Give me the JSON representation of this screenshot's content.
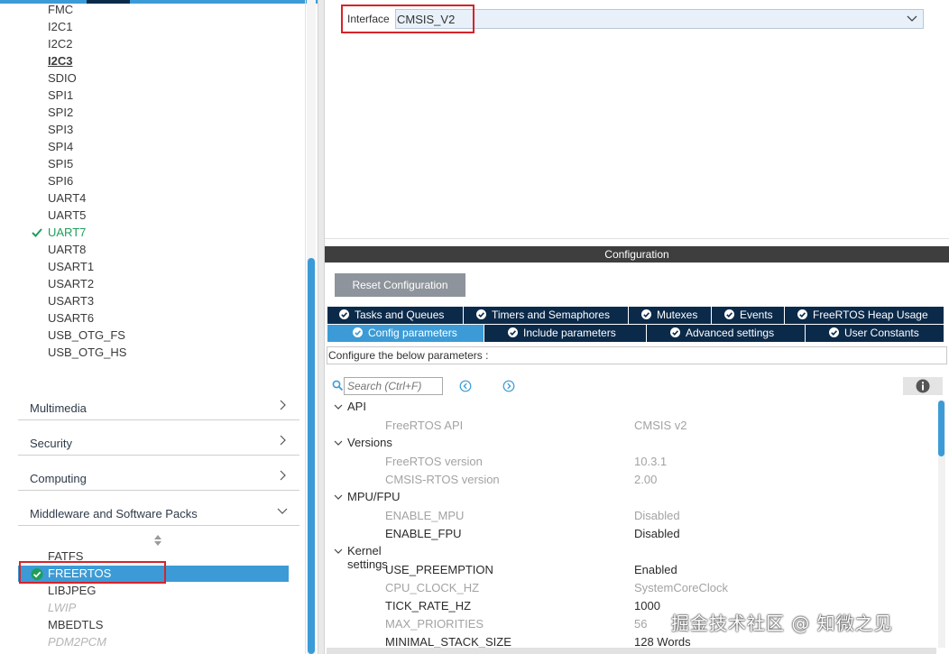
{
  "peripherals": [
    {
      "label": "FMC",
      "style": "normal"
    },
    {
      "label": "I2C1",
      "style": "normal"
    },
    {
      "label": "I2C2",
      "style": "normal"
    },
    {
      "label": "I2C3",
      "style": "bold"
    },
    {
      "label": "SDIO",
      "style": "normal"
    },
    {
      "label": "SPI1",
      "style": "normal"
    },
    {
      "label": "SPI2",
      "style": "normal"
    },
    {
      "label": "SPI3",
      "style": "normal"
    },
    {
      "label": "SPI4",
      "style": "normal"
    },
    {
      "label": "SPI5",
      "style": "normal"
    },
    {
      "label": "SPI6",
      "style": "normal"
    },
    {
      "label": "UART4",
      "style": "normal"
    },
    {
      "label": "UART5",
      "style": "normal"
    },
    {
      "label": "UART7",
      "style": "green"
    },
    {
      "label": "UART8",
      "style": "normal"
    },
    {
      "label": "USART1",
      "style": "normal"
    },
    {
      "label": "USART2",
      "style": "normal"
    },
    {
      "label": "USART3",
      "style": "normal"
    },
    {
      "label": "USART6",
      "style": "normal"
    },
    {
      "label": "USB_OTG_FS",
      "style": "normal"
    },
    {
      "label": "USB_OTG_HS",
      "style": "normal"
    }
  ],
  "categories": [
    {
      "label": "Multimedia",
      "state": "collapsed"
    },
    {
      "label": "Security",
      "state": "collapsed"
    },
    {
      "label": "Computing",
      "state": "collapsed"
    },
    {
      "label": "Middleware and Software Packs",
      "state": "expanded"
    }
  ],
  "middleware": [
    {
      "label": "FATFS",
      "style": "normal"
    },
    {
      "label": "FREERTOS",
      "style": "selected"
    },
    {
      "label": "LIBJPEG",
      "style": "normal"
    },
    {
      "label": "LWIP",
      "style": "disabled"
    },
    {
      "label": "MBEDTLS",
      "style": "normal"
    },
    {
      "label": "PDM2PCM",
      "style": "disabled"
    }
  ],
  "interface": {
    "label": "Interface",
    "value": "CMSIS_V2"
  },
  "configuration": {
    "title": "Configuration",
    "reset_label": "Reset Configuration",
    "tabs_row1": [
      {
        "label": "Tasks and Queues",
        "active": false
      },
      {
        "label": "Timers and Semaphores",
        "active": false
      },
      {
        "label": "Mutexes",
        "active": false
      },
      {
        "label": "Events",
        "active": false
      },
      {
        "label": "FreeRTOS Heap Usage",
        "active": false
      }
    ],
    "tabs_row2": [
      {
        "label": "Config parameters",
        "active": true
      },
      {
        "label": "Include parameters",
        "active": false
      },
      {
        "label": "Advanced settings",
        "active": false
      },
      {
        "label": "User Constants",
        "active": false
      }
    ],
    "description": "Configure the below parameters :",
    "search_placeholder": "Search (Ctrl+F)"
  },
  "param_groups": [
    {
      "name": "API",
      "params": [
        {
          "name": "FreeRTOS API",
          "value": "CMSIS v2",
          "editable": false
        }
      ]
    },
    {
      "name": "Versions",
      "params": [
        {
          "name": "FreeRTOS version",
          "value": "10.3.1",
          "editable": false
        },
        {
          "name": "CMSIS-RTOS version",
          "value": "2.00",
          "editable": false
        }
      ]
    },
    {
      "name": "MPU/FPU",
      "params": [
        {
          "name": "ENABLE_MPU",
          "value": "Disabled",
          "editable": false
        },
        {
          "name": "ENABLE_FPU",
          "value": "Disabled",
          "editable": true
        }
      ]
    },
    {
      "name": "Kernel settings",
      "params": [
        {
          "name": "USE_PREEMPTION",
          "value": "Enabled",
          "editable": true
        },
        {
          "name": "CPU_CLOCK_HZ",
          "value": "SystemCoreClock",
          "editable": false
        },
        {
          "name": "TICK_RATE_HZ",
          "value": "1000",
          "editable": true
        },
        {
          "name": "MAX_PRIORITIES",
          "value": "56",
          "editable": false
        },
        {
          "name": "MINIMAL_STACK_SIZE",
          "value": "128 Words",
          "editable": true
        }
      ]
    }
  ],
  "watermark": "掘金技术社区 @ 知微之见",
  "colors": {
    "accent": "#3c9bd6",
    "tab_dark": "#0b2a4a",
    "highlight": "#d6232a",
    "ok_green": "#1e9e5a"
  }
}
